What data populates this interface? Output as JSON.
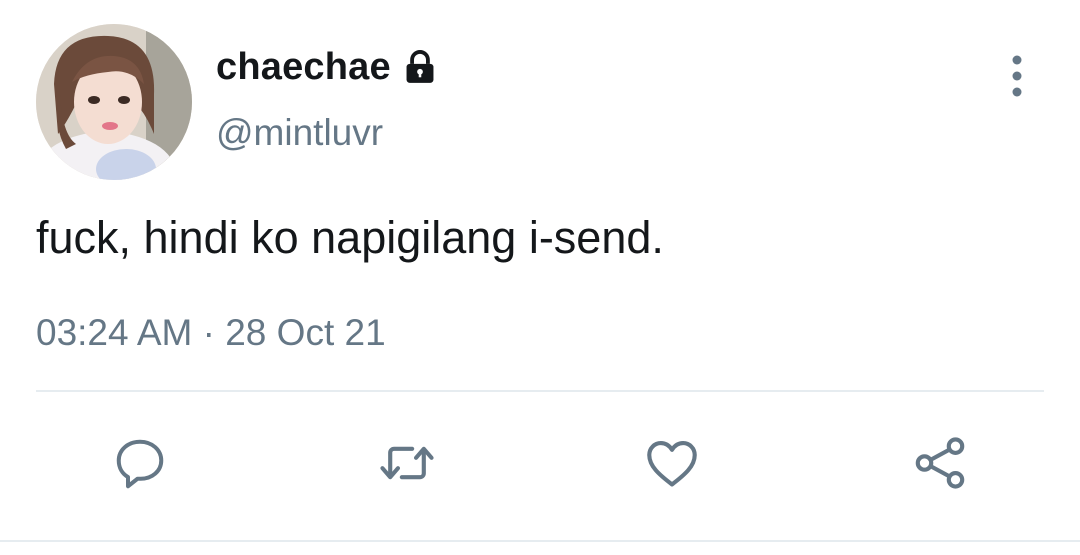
{
  "user": {
    "display_name": "chaechae",
    "handle": "@mintluvr",
    "protected_icon": "lock-icon"
  },
  "tweet": {
    "text": "fuck, hindi ko napigilang i-send.",
    "time": "03:24 AM",
    "separator": "·",
    "date": "28 Oct 21"
  },
  "actions": {
    "reply_icon": "reply-icon",
    "retweet_icon": "retweet-icon",
    "like_icon": "heart-icon",
    "share_icon": "share-icon"
  },
  "colors": {
    "text_primary": "#14171a",
    "text_secondary": "#657786",
    "divider": "#e6ecf0"
  }
}
